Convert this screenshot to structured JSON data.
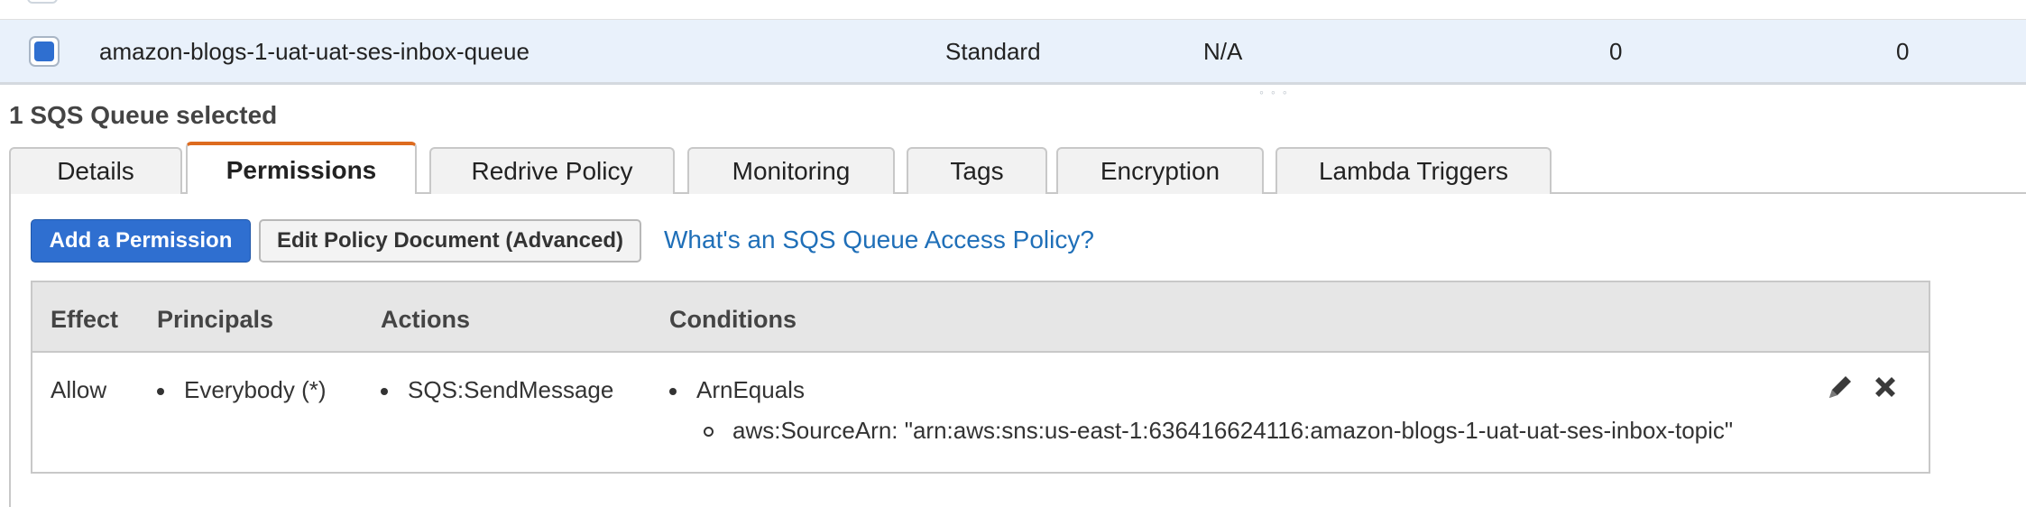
{
  "queue_row": {
    "name": "amazon-blogs-1-uat-uat-ses-inbox-queue",
    "type": "Standard",
    "content_based_deduplication": "N/A",
    "messages_available": "0",
    "messages_in_flight": "0",
    "selected": true
  },
  "resize_handle": "◦ ◦ ◦",
  "selection_summary": "1 SQS Queue selected",
  "tabs": [
    {
      "label": "Details",
      "active": false
    },
    {
      "label": "Permissions",
      "active": true
    },
    {
      "label": "Redrive Policy",
      "active": false
    },
    {
      "label": "Monitoring",
      "active": false
    },
    {
      "label": "Tags",
      "active": false
    },
    {
      "label": "Encryption",
      "active": false
    },
    {
      "label": "Lambda Triggers",
      "active": false
    }
  ],
  "toolbar": {
    "add_permission_label": "Add a Permission",
    "edit_policy_label": "Edit Policy Document (Advanced)",
    "help_link_label": "What's an SQS Queue Access Policy?"
  },
  "policy_table": {
    "columns": [
      "Effect",
      "Principals",
      "Actions",
      "Conditions"
    ],
    "rows": [
      {
        "effect": "Allow",
        "principals": [
          "Everybody (*)"
        ],
        "actions": [
          "SQS:SendMessage"
        ],
        "condition_operator": "ArnEquals",
        "condition_detail": "aws:SourceArn: \"arn:aws:sns:us-east-1:636416624116:amazon-blogs-1-uat-uat-ses-inbox-topic\""
      }
    ],
    "row_actions": [
      "pencil-icon",
      "close-icon"
    ]
  },
  "colors": {
    "primary": "#2f6fd0",
    "link": "#1f6fb8",
    "active_tab_accent": "#dd6b1f",
    "selected_row_bg": "#e9f1fb"
  }
}
